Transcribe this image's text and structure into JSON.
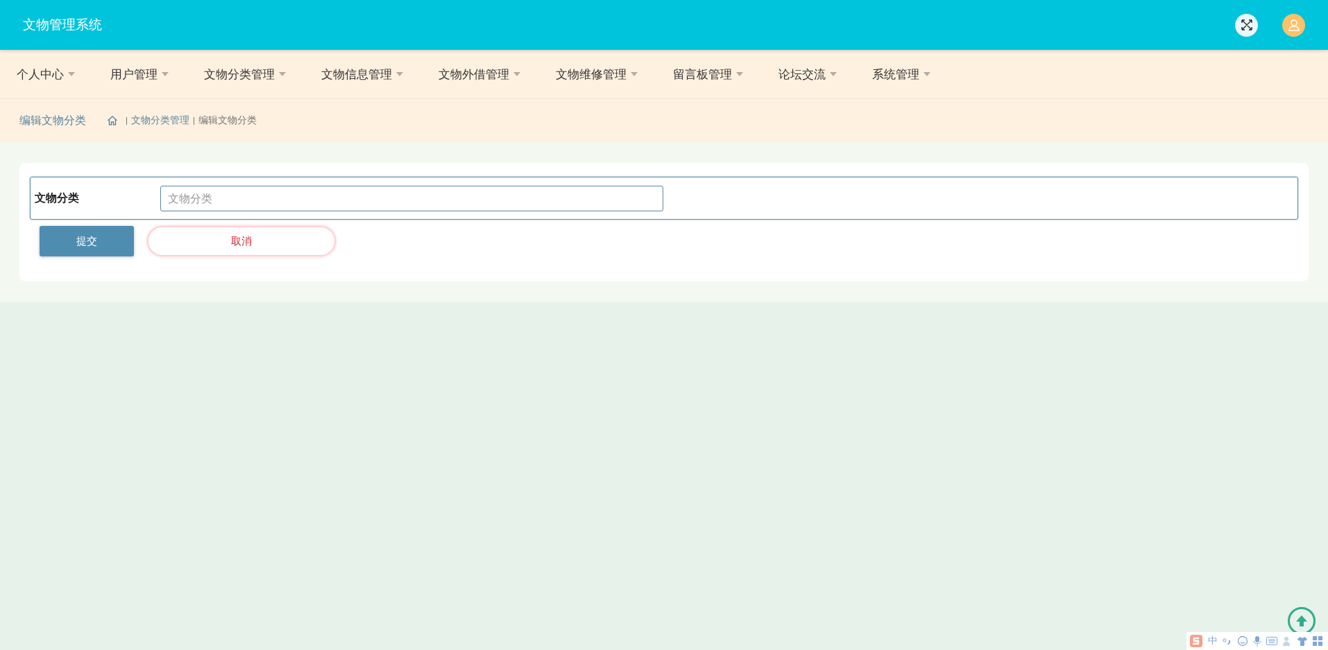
{
  "header": {
    "title": "文物管理系统"
  },
  "menu": [
    {
      "label": "个人中心"
    },
    {
      "label": "用户管理"
    },
    {
      "label": "文物分类管理"
    },
    {
      "label": "文物信息管理"
    },
    {
      "label": "文物外借管理"
    },
    {
      "label": "文物维修管理"
    },
    {
      "label": "留言板管理"
    },
    {
      "label": "论坛交流"
    },
    {
      "label": "系统管理"
    }
  ],
  "breadcrumb": {
    "page_title": "编辑文物分类",
    "trail": [
      "文物分类管理",
      "编辑文物分类"
    ]
  },
  "form": {
    "fields": [
      {
        "label": "文物分类",
        "placeholder": "文物分类"
      }
    ],
    "buttons": [
      {
        "label": "提交",
        "kind": "primary"
      },
      {
        "label": "取消",
        "kind": "cancel"
      }
    ]
  },
  "ime_toolbar": {
    "mode": "中"
  }
}
